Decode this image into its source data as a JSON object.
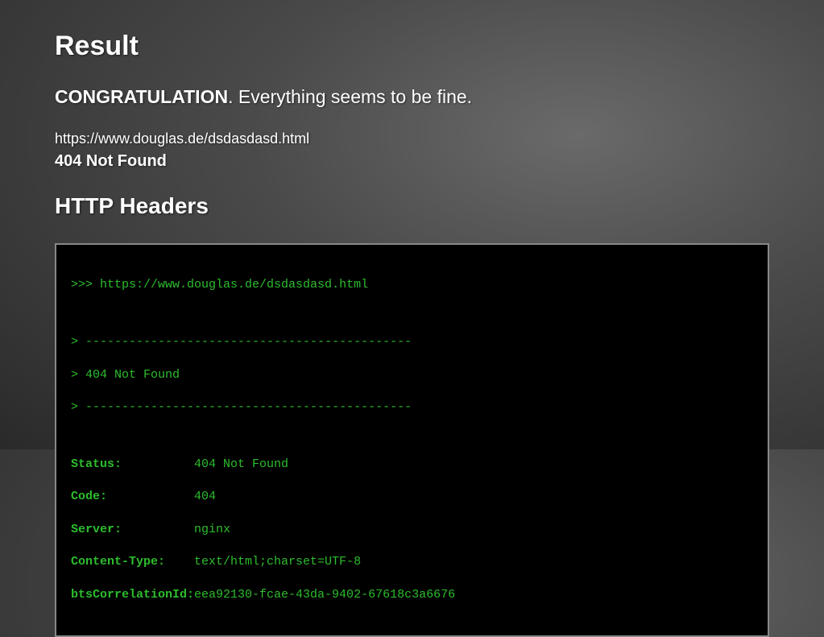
{
  "heading_result": "Result",
  "congrat_strong": "CONGRATULATION",
  "congrat_rest": ". Everything seems to be fine.",
  "url": "https://www.douglas.de/dsdasdasd.html",
  "http_status": "404 Not Found",
  "heading_headers": "HTTP Headers",
  "terminal": {
    "prompt": ">>> ",
    "url": "https://www.douglas.de/dsdasdasd.html",
    "div_prefix": "> ",
    "divider": "---------------------------------------------",
    "status_line": "404 Not Found",
    "kv": {
      "status_k": "Status:",
      "status_v": "404 Not Found",
      "code_k": "Code:",
      "code_v": "404",
      "server_k": "Server:",
      "server_v": "nginx",
      "ctype_k": "Content-Type:",
      "ctype_v": "text/html;charset=UTF-8",
      "corr_k": "btsCorrelationId:",
      "corr_v": "eea92130-fcae-43da-9402-67618c3a6676"
    }
  }
}
